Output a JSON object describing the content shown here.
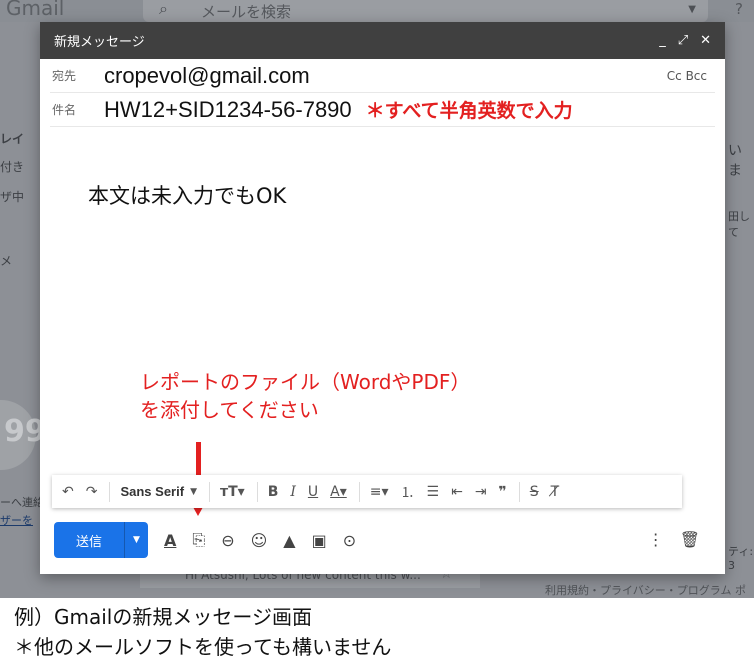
{
  "background": {
    "logo": "Gmail",
    "search_placeholder": "メールを検索",
    "side_items": [
      "レイ",
      "付き",
      "ザ中",
      "メ"
    ],
    "right_texts": [
      "いま",
      "田して"
    ],
    "chat_snippets": [
      "ーへ連絡",
      "ザーを"
    ],
    "mail_preview": "Hi Atsushi, Lots of new content this w...",
    "footer": "利用規約・プライバシー・プログラム ポ",
    "right_bottom": "ティ: 3"
  },
  "compose": {
    "title": "新規メッセージ",
    "to_label": "宛先",
    "to_value": "cropevol@gmail.com",
    "ccbcc": "Cc Bcc",
    "subject_label": "件名",
    "subject_value": "HW12+SID1234-56-7890",
    "subject_note": "＊すべて半角英数で入力",
    "body": "本文は未入力でもOK",
    "callout_line1": "レポートのファイル（WordやPDF）",
    "callout_line2": "を添付してください",
    "font_name": "Sans Serif",
    "send_label": "送信"
  },
  "caption": {
    "line1": "例）Gmailの新規メッセージ画面",
    "line2": "＊他のメールソフトを使っても構いません"
  },
  "colors": {
    "accent": "#1a73e8",
    "note_red": "#e32020",
    "header_dark": "#404040"
  }
}
